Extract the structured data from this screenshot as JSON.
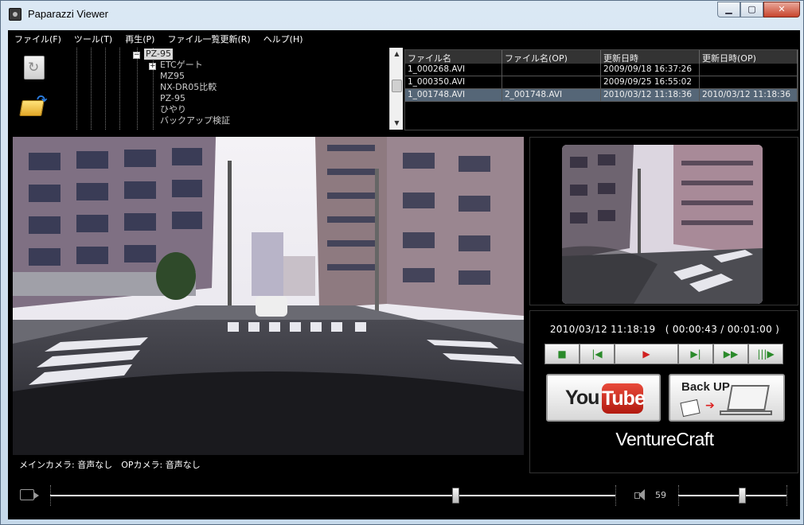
{
  "window": {
    "title": "Paparazzi Viewer"
  },
  "menu": {
    "items": [
      {
        "label": "ファイル(F)"
      },
      {
        "label": "ツール(T)"
      },
      {
        "label": "再生(P)"
      },
      {
        "label": "ファイル一覧更新(R)"
      },
      {
        "label": "ヘルプ(H)"
      }
    ]
  },
  "tree": {
    "nodes": [
      {
        "label": "PZ-95",
        "selected": true
      },
      {
        "label": "ETCゲート"
      },
      {
        "label": "MZ95"
      },
      {
        "label": "NX-DR05比較"
      },
      {
        "label": "PZ-95"
      },
      {
        "label": "ひやり"
      },
      {
        "label": "バックアップ検証"
      }
    ]
  },
  "files": {
    "headers": [
      "ファイル名",
      "ファイル名(OP)",
      "更新日時",
      "更新日時(OP)"
    ],
    "rows": [
      [
        "1_000268.AVI",
        "",
        "2009/09/18 16:37:26",
        ""
      ],
      [
        "1_000350.AVI",
        "",
        "2009/09/25 16:55:02",
        ""
      ],
      [
        "1_001748.AVI",
        "2_001748.AVI",
        "2010/03/12 11:18:36",
        "2010/03/12 11:18:36"
      ]
    ],
    "selected_row": 2
  },
  "status": {
    "text": "メインカメラ: 音声なし　OPカメラ: 音声なし"
  },
  "playback": {
    "timecode": "2010/03/12 11:18:19　( 00:00:43 / 00:01:00 )",
    "seek_fraction": 0.7167,
    "volume": "59",
    "volume_fraction": 0.59
  },
  "buttons": {
    "youtube_you": "You",
    "youtube_tube": "Tube",
    "backup_label": "Back UP",
    "transport": {
      "stop": "■",
      "prev": "|◀",
      "play": "▶",
      "next": "▶|",
      "ff": "▶▶",
      "step": "|||▶"
    }
  },
  "brand": {
    "name": "VentureCraft"
  },
  "icons": {
    "app": "app-icon",
    "refresh": "refresh-icon",
    "open_folder": "open-folder-icon",
    "camera": "video-camera-icon",
    "speaker": "speaker-icon"
  }
}
